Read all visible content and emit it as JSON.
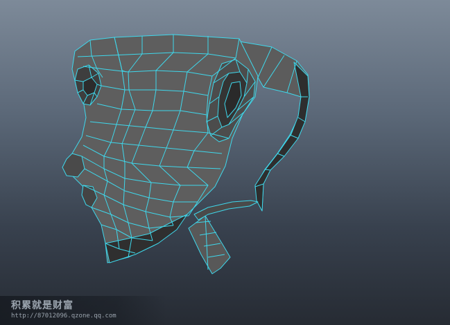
{
  "viewport": {
    "background_top": "#7d8a99",
    "background_bottom": "#262b33",
    "wireframe_color": "#3fd8ec",
    "surface_color": "#5c5c5c",
    "surface_dark": "#3a3a3a"
  },
  "watermark": {
    "title": "积累就是财富",
    "url": "http://87012096.qzone.qq.com"
  }
}
